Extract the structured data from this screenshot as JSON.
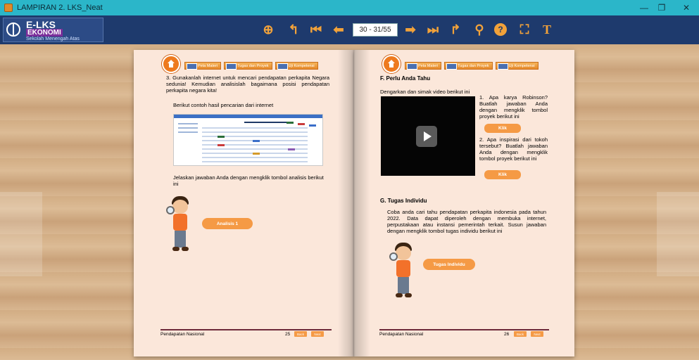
{
  "window": {
    "title": "LAMPIRAN 2. LKS_Neat",
    "minimize_glyph": "—",
    "restore_glyph": "❐",
    "close_glyph": "✕"
  },
  "logo": {
    "line1": "E-LKS",
    "line2": "EKONOMI",
    "line3": "Sekolah Menengah Atas"
  },
  "toolbar": {
    "zoom_in_icon": "⊕",
    "back_icon": "↰",
    "first_icon": "⏮",
    "prev_icon": "⬅",
    "page_indicator": "30 - 31/55",
    "next_icon": "➡",
    "last_icon": "⏭",
    "forward_icon": "↱",
    "search_icon": "⚲",
    "help_icon": "?",
    "fullscreen_icon": "⛶",
    "text_icon": "T"
  },
  "nav_buttons": [
    "Peta Materi",
    "Tugas dan Proyek",
    "Uji Kompetensi"
  ],
  "left_page": {
    "item3": "3.  Gunakanlah internet untuk mencari pendapatan perkapita Negara sedunia! Kemudian analisislah bagaimana posisi pendapatan perkapita negara kita!",
    "example_text": "Berikut contoh hasil pencarian dari internet",
    "explain_text": "Jelaskan jawaban Anda dengan mengklik tombol analisis berikut ini",
    "analysis_button": "Analisis 1",
    "footer_text": "Pendapatan Nasional",
    "page_number": "25",
    "back_label": "Back",
    "next_label": "Next"
  },
  "right_page": {
    "section_f_title": "F. Perlu Anda Tahu",
    "video_instruction": "Dengarkan dan simak video berikut ini",
    "q1": "1.  Apa karya Robinson? Buatlah jawaban Anda dengan mengklik tombol proyek berikut ini",
    "q1_button": "Klik",
    "q2": "2.  Apa inspirasi dari tokoh tersebut? Buatlah jawaban Anda dengan mengklik tombol proyek berikut ini",
    "q2_button": "Klik",
    "section_g_title": "G. Tugas Individu",
    "task_text": "Coba anda cari tahu pendapatan perkapita indonesia pada tahun 2022. Data dapat diperoleh dengan membuka internet, perpustakaan atau instansi pemerintah terkait. Susun jawaban dengan mengklik tombol tugas individu berikut ini",
    "task_button": "Tugas Individu",
    "footer_text": "Pendapatan Nasional",
    "page_number": "26",
    "back_label": "Back",
    "next_label": "Next"
  },
  "colors": {
    "titlebar": "#2bb6c9",
    "toolbar": "#1e3a6d",
    "toolbar_icon": "#f2a23a",
    "page": "#fbe7da",
    "orange_button": "#f59a45"
  }
}
